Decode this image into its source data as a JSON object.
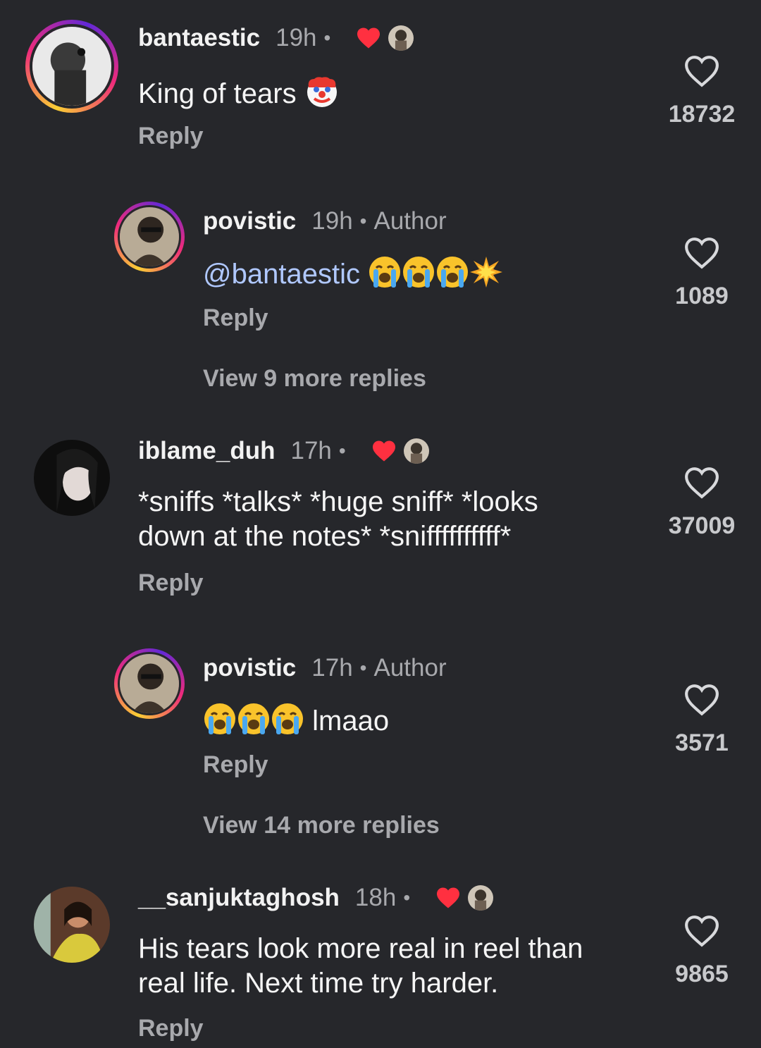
{
  "comments": [
    {
      "username": "bantaestic",
      "time": "19h",
      "dot": "•",
      "text": "King of tears",
      "emoji": "clown-face",
      "reply": "Reply",
      "likes": "18732",
      "liked_by_author": true
    },
    {
      "username": "povistic",
      "time": "19h",
      "dot": "•",
      "author": "Author",
      "mention": "@bantaestic",
      "emoji": "loudly-crying-face x3, collision",
      "reply": "Reply",
      "likes": "1089",
      "more_replies": "View 9 more replies"
    },
    {
      "username": "iblame_duh",
      "time": "17h",
      "dot": "•",
      "text_line1": "*sniffs *talks* *huge sniff* *looks",
      "text_line2": "down at the notes* *sniffffffffff*",
      "reply": "Reply",
      "likes": "37009",
      "liked_by_author": true
    },
    {
      "username": "povistic",
      "time": "17h",
      "dot": "•",
      "author": "Author",
      "text": "lmaao",
      "emoji": "loudly-crying-face x3",
      "reply": "Reply",
      "likes": "3571",
      "more_replies": "View 14 more replies"
    },
    {
      "username": "__sanjuktaghosh",
      "time": "18h",
      "dot": "•",
      "text_line1": "His tears look more real in reel than",
      "text_line2": "real life. Next time try harder.",
      "reply": "Reply",
      "likes": "9865",
      "liked_by_author": true
    }
  ],
  "colors": {
    "background": "#26272b",
    "liked_heart": "#ff3040",
    "mention": "#b0c8ff",
    "muted": "#a8a9ad"
  }
}
